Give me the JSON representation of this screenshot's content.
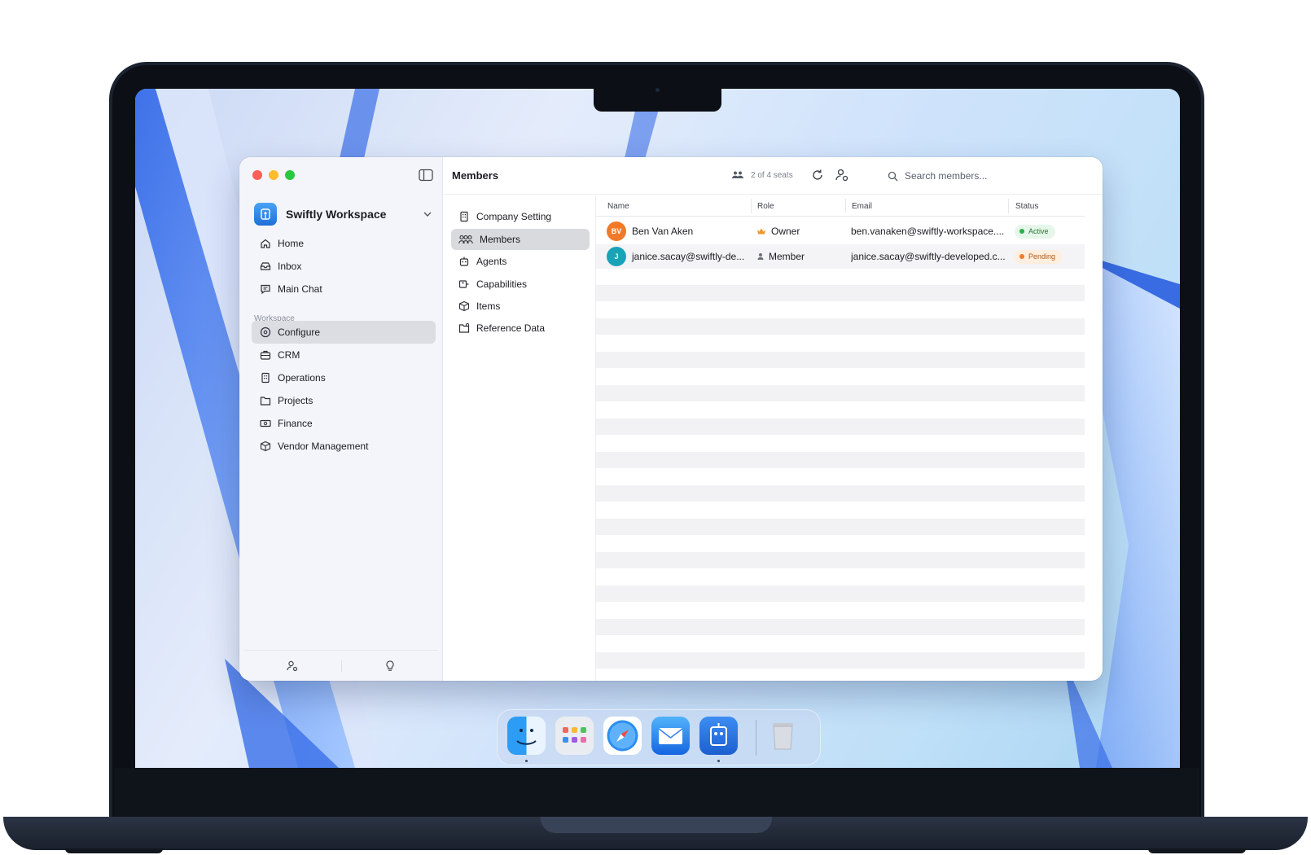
{
  "window": {
    "title": "Members"
  },
  "sidebar": {
    "workspace_name": "Swiftly Workspace",
    "items": [
      {
        "label": "Home",
        "icon": "home-icon"
      },
      {
        "label": "Inbox",
        "icon": "inbox-icon"
      },
      {
        "label": "Main Chat",
        "icon": "chat-icon"
      }
    ],
    "section_label": "Workspace",
    "workspace_items": [
      {
        "label": "Configure",
        "icon": "configure-icon",
        "selected": true
      },
      {
        "label": "CRM",
        "icon": "briefcase-icon"
      },
      {
        "label": "Operations",
        "icon": "building-icon"
      },
      {
        "label": "Projects",
        "icon": "folder-icon"
      },
      {
        "label": "Finance",
        "icon": "banknote-icon"
      },
      {
        "label": "Vendor Management",
        "icon": "box-icon"
      }
    ]
  },
  "toolbar": {
    "seats": "2 of 4 seats",
    "search_placeholder": "Search members..."
  },
  "subnav": {
    "items": [
      {
        "label": "Company Setting",
        "icon": "building-icon"
      },
      {
        "label": "Members",
        "icon": "users-icon",
        "selected": true
      },
      {
        "label": "Agents",
        "icon": "robot-icon"
      },
      {
        "label": "Capabilities",
        "icon": "plug-icon"
      },
      {
        "label": "Items",
        "icon": "cube-icon"
      },
      {
        "label": "Reference Data",
        "icon": "folder-data-icon"
      }
    ]
  },
  "table": {
    "columns": [
      "Name",
      "Role",
      "Email",
      "Status"
    ],
    "rows": [
      {
        "initials": "BV",
        "avatar_color": "#f07a2a",
        "name": "Ben Van Aken",
        "role": "Owner",
        "role_icon": "crown-icon",
        "email": "ben.vanaken@swiftly-workspace....",
        "status": "Active",
        "status_color": "#27b04a",
        "status_bg": "#e7f6ea"
      },
      {
        "initials": "J",
        "avatar_color": "#1aa3b8",
        "name": "janice.sacay@swiftly-de...",
        "role": "Member",
        "role_icon": "person-icon",
        "email": "janice.sacay@swiftly-developed.c...",
        "status": "Pending",
        "status_color": "#f07a2a",
        "status_bg": "#fdeede"
      }
    ]
  },
  "dock": {
    "apps": [
      "finder-icon",
      "launchpad-icon",
      "safari-icon",
      "mail-icon",
      "swiftly-app-icon",
      "trash-icon"
    ]
  }
}
